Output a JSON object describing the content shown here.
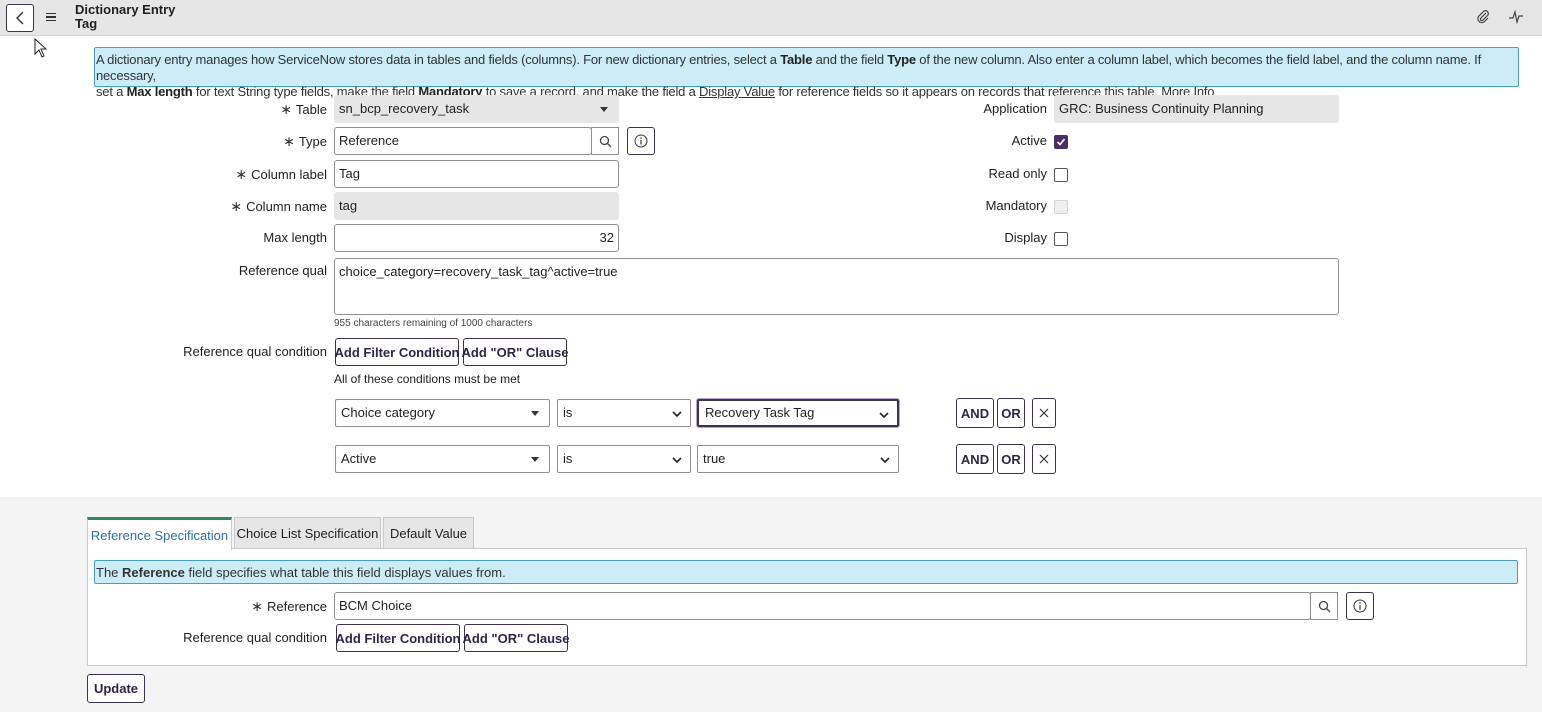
{
  "header": {
    "title": "Dictionary Entry",
    "subtitle": "Tag"
  },
  "info_banner": {
    "p1": "A dictionary entry manages how ServiceNow stores data in tables and fields (columns). For new dictionary entries, select a ",
    "b1": "Table",
    "p2": " and the field ",
    "b2": "Type",
    "p3": " of the new column. Also enter a column label, which becomes the field label, and the column name. If necessary,",
    "p4": "set a ",
    "b3": "Max length",
    "p5": " for text String type fields, make the field ",
    "b4": "Mandatory",
    "p6": " to save a record, and make the field a ",
    "link1": "Display Value",
    "p7": " for reference fields so it appears on records that reference this table. ",
    "link2": "More Info"
  },
  "form": {
    "required_mark": "∗",
    "table_label": "Table",
    "table_value": "sn_bcp_recovery_task",
    "type_label": "Type",
    "type_value": "Reference",
    "column_label_label": "Column label",
    "column_label_value": "Tag",
    "column_name_label": "Column name",
    "column_name_value": "tag",
    "max_length_label": "Max length",
    "max_length_value": "32",
    "reference_qual_label": "Reference qual",
    "reference_qual_value": "choice_category=recovery_task_tag^active=true",
    "chars_remaining": "955 characters remaining of 1000 characters",
    "ref_qual_condition_label": "Reference qual condition",
    "add_filter_label": "Add Filter Condition",
    "add_or_label": "Add \"OR\" Clause",
    "conditions_met": "All of these conditions must be met",
    "application_label": "Application",
    "application_value": "GRC: Business Continuity Planning",
    "active_label": "Active",
    "read_only_label": "Read only",
    "mandatory_label": "Mandatory",
    "display_label": "Display"
  },
  "conditions": [
    {
      "field": "Choice category",
      "operator": "is",
      "value": "Recovery Task Tag",
      "and": "AND",
      "or": "OR"
    },
    {
      "field": "Active",
      "operator": "is",
      "value": "true",
      "and": "AND",
      "or": "OR"
    }
  ],
  "tabs": [
    {
      "label": "Reference Specification"
    },
    {
      "label": "Choice List Specification"
    },
    {
      "label": "Default Value"
    }
  ],
  "ref_spec": {
    "info_p1": "The ",
    "info_b": "Reference",
    "info_p2": " field specifies what table this field displays values from.",
    "reference_label": "Reference",
    "reference_value": "BCM Choice",
    "ref_qual_condition_label": "Reference qual condition",
    "add_filter_label": "Add Filter Condition",
    "add_or_label": "Add \"OR\" Clause"
  },
  "update_label": "Update"
}
